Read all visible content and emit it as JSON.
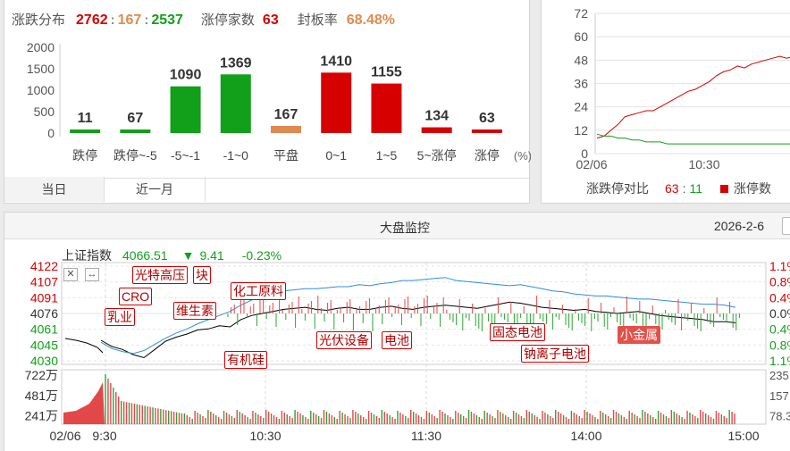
{
  "dist_panel": {
    "title": "涨跌分布",
    "up_count": "2762",
    "flat_count": "167",
    "down_count": "2537",
    "sep": ":",
    "limit_label": "涨停家数",
    "limit_count": "63",
    "seal_label": "封板率",
    "seal_rate": "68.48%",
    "unit": "(%)",
    "tabs": [
      "当日",
      "近一月"
    ]
  },
  "limit_panel": {
    "legend_label": "涨跌停对比",
    "up_val": "63",
    "down_val": "11",
    "colon": ":",
    "legend_limit": "涨停数"
  },
  "market": {
    "title": "大盘监控",
    "date": "2026-2-6",
    "index_name": "上证指数",
    "index_value": "4066.51",
    "change_arrow": "▼",
    "change": "9.41",
    "change_pct": "-0.23%",
    "tags": [
      {
        "text": "光特高压",
        "style": "outline"
      },
      {
        "text": "块",
        "style": "outline"
      },
      {
        "text": "CRO",
        "style": "outline"
      },
      {
        "text": "乳业",
        "style": "outline"
      },
      {
        "text": "维生素",
        "style": "outline"
      },
      {
        "text": "化工原料",
        "style": "outline"
      },
      {
        "text": "有机硅",
        "style": "outline"
      },
      {
        "text": "光伏设备",
        "style": "outline"
      },
      {
        "text": "电池",
        "style": "outline"
      },
      {
        "text": "固态电池",
        "style": "outline"
      },
      {
        "text": "钠离子电池",
        "style": "outline"
      },
      {
        "text": "小金属",
        "style": "filled"
      }
    ]
  },
  "colors": {
    "up": "#d60000",
    "down": "#129f1a",
    "flat": "#e08a4f",
    "line_blue": "#2f8fd8"
  },
  "chart_data": [
    {
      "type": "bar",
      "categories": [
        "跌停",
        "跌停~-5",
        "-5~-1",
        "-1~0",
        "平盘",
        "0~1",
        "1~5",
        "5~涨停",
        "涨停"
      ],
      "values": [
        11,
        67,
        1090,
        1369,
        167,
        1410,
        1155,
        134,
        63
      ],
      "bar_colors": [
        "#129f1a",
        "#129f1a",
        "#129f1a",
        "#129f1a",
        "#e08a4f",
        "#d60000",
        "#d60000",
        "#d60000",
        "#d60000"
      ],
      "yticks": [
        "2000",
        "1500",
        "1000",
        "500",
        "0"
      ],
      "ylim": [
        0,
        2000
      ]
    },
    {
      "type": "line",
      "x_ticks": [
        "02/06",
        "10:30"
      ],
      "yticks": [
        "72",
        "60",
        "48",
        "36",
        "24",
        "12",
        "0"
      ],
      "ylim": [
        0,
        72
      ],
      "series": [
        {
          "name": "涨停数",
          "color": "#d60000",
          "values": [
            8,
            9,
            12,
            15,
            19,
            20,
            21,
            22,
            22,
            24,
            26,
            28,
            30,
            32,
            33,
            35,
            37,
            40,
            42,
            43,
            45,
            44,
            46,
            47,
            48,
            49,
            50,
            49,
            50,
            50
          ]
        },
        {
          "name": "跌停数",
          "color": "#129f1a",
          "values": [
            10,
            9,
            9,
            8,
            8,
            7,
            7,
            6,
            6,
            6,
            5,
            5,
            5,
            5,
            5,
            5,
            5,
            5,
            5,
            5,
            5,
            5,
            5,
            5,
            5,
            5,
            5,
            5,
            5,
            5
          ]
        }
      ]
    },
    {
      "type": "line",
      "x_ticks": [
        "02/06",
        "9:30",
        "10:30",
        "11:30",
        "14:00",
        "15:00"
      ],
      "yticks_left": [
        "4122",
        "4107",
        "4091",
        "4076",
        "4061",
        "4045",
        "4030"
      ],
      "yticks_right": [
        "1.1%",
        "0.8%",
        "0.4%",
        "0.0%",
        "0.4%",
        "0.8%",
        "1.1%"
      ],
      "vol_ticks_left": [
        "722万",
        "481万",
        "241万"
      ],
      "vol_ticks_right": [
        "235",
        "157",
        "78.3"
      ],
      "ylim": [
        4030,
        4122
      ],
      "series": [
        {
          "name": "上证指数",
          "color": "#000000",
          "values": [
            4050,
            4044,
            4041,
            4036,
            4033,
            4041,
            4049,
            4053,
            4056,
            4060,
            4061,
            4064,
            4063,
            4070,
            4074,
            4076,
            4078,
            4080,
            4081,
            4082,
            4080,
            4079,
            4081,
            4082,
            4080,
            4080,
            4082,
            4083,
            4081,
            4080,
            4082,
            4083,
            4084,
            4083,
            4082,
            4081,
            4083,
            4085,
            4087,
            4086,
            4084,
            4082,
            4081,
            4080,
            4079,
            4080,
            4078,
            4077,
            4076,
            4077,
            4078,
            4076,
            4074,
            4073,
            4072,
            4071,
            4070,
            4068,
            4068,
            4067
          ]
        },
        {
          "name": "",
          "color": "#2f8fd8",
          "values": [
            4048,
            4042,
            4039,
            4037,
            4040,
            4046,
            4052,
            4057,
            4061,
            4066,
            4070,
            4074,
            4078,
            4084,
            4089,
            4094,
            4097,
            4098,
            4099,
            4100,
            4100,
            4101,
            4102,
            4102,
            4104,
            4103,
            4105,
            4106,
            4108,
            4108,
            4109,
            4110,
            4111,
            4108,
            4107,
            4106,
            4105,
            4104,
            4103,
            4104,
            4102,
            4100,
            4098,
            4097,
            4095,
            4094,
            4093,
            4093,
            4092,
            4091,
            4090,
            4090,
            4089,
            4088,
            4087,
            4086,
            4085,
            4085,
            4084,
            4082
          ]
        }
      ]
    }
  ]
}
